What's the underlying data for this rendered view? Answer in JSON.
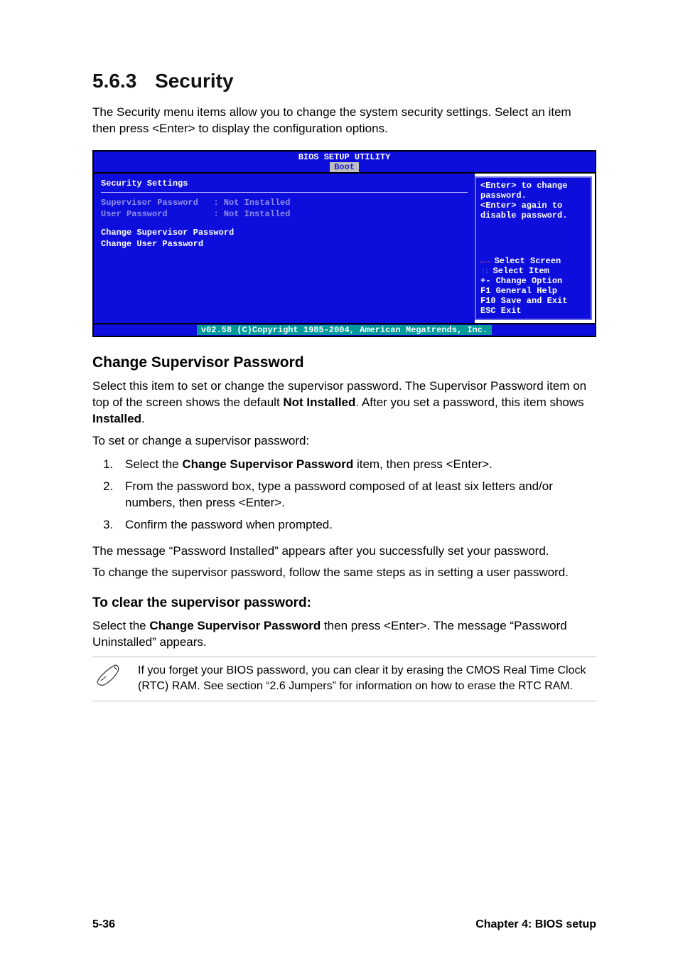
{
  "heading": {
    "number": "5.6.3",
    "title": "Security"
  },
  "intro": "The Security menu items allow you to change the system security settings. Select an item then press <Enter> to display the configuration options.",
  "bios": {
    "title": "BIOS SETUP UTILITY",
    "tab": "Boot",
    "panel_title": "Security Settings",
    "rows": {
      "sup_label": "Supervisor Password",
      "sup_value": ": Not Installed",
      "usr_label": "User Password",
      "usr_value": ": Not Installed"
    },
    "items": {
      "change_sup": "Change Supervisor Password",
      "change_usr": "Change User Password"
    },
    "help_top": {
      "l1": "<Enter> to change",
      "l2": "password.",
      "l3": "<Enter> again to",
      "l4": "disable password."
    },
    "help_bot": {
      "select_screen": " Select Screen",
      "select_item": "  Select Item",
      "change_option": "+-  Change Option",
      "general_help": "F1  General Help",
      "save_exit": "F10 Save and Exit",
      "esc": "ESC Exit"
    },
    "footer": "v02.58 (C)Copyright 1985-2004, American Megatrends, Inc."
  },
  "h3_change_sup": "Change Supervisor Password",
  "para_sup_1a": "Select this item to set or change the supervisor password. The Supervisor Password item on top of the screen shows the default ",
  "bold_not_installed": "Not Installed",
  "para_sup_1b": ". After you set a password, this item shows ",
  "bold_installed": "Installed",
  "para_sup_1c": ".",
  "para_sup_2": "To set or change a supervisor password:",
  "steps": {
    "s1a": "Select the ",
    "s1b": "Change Supervisor Password",
    "s1c": " item, then press <Enter>.",
    "s2": "From the password box, type a password composed of at least six letters and/or numbers, then press <Enter>.",
    "s3": "Confirm the password when prompted."
  },
  "para_sup_3": "The message “Password Installed” appears after you successfully set your password.",
  "para_sup_4": "To change the supervisor password, follow the same steps as in setting a user password.",
  "h4_clear": "To clear the supervisor password:",
  "para_clear_a": "Select the ",
  "para_clear_b": "Change Supervisor Password",
  "para_clear_c": " then press <Enter>. The message “Password Uninstalled” appears.",
  "note_text": "If you forget your BIOS password, you can clear it by erasing the CMOS Real Time Clock (RTC) RAM. See section “2.6  Jumpers” for information on how to erase the RTC RAM.",
  "footer_left": "5-36",
  "footer_right": "Chapter 4: BIOS setup"
}
